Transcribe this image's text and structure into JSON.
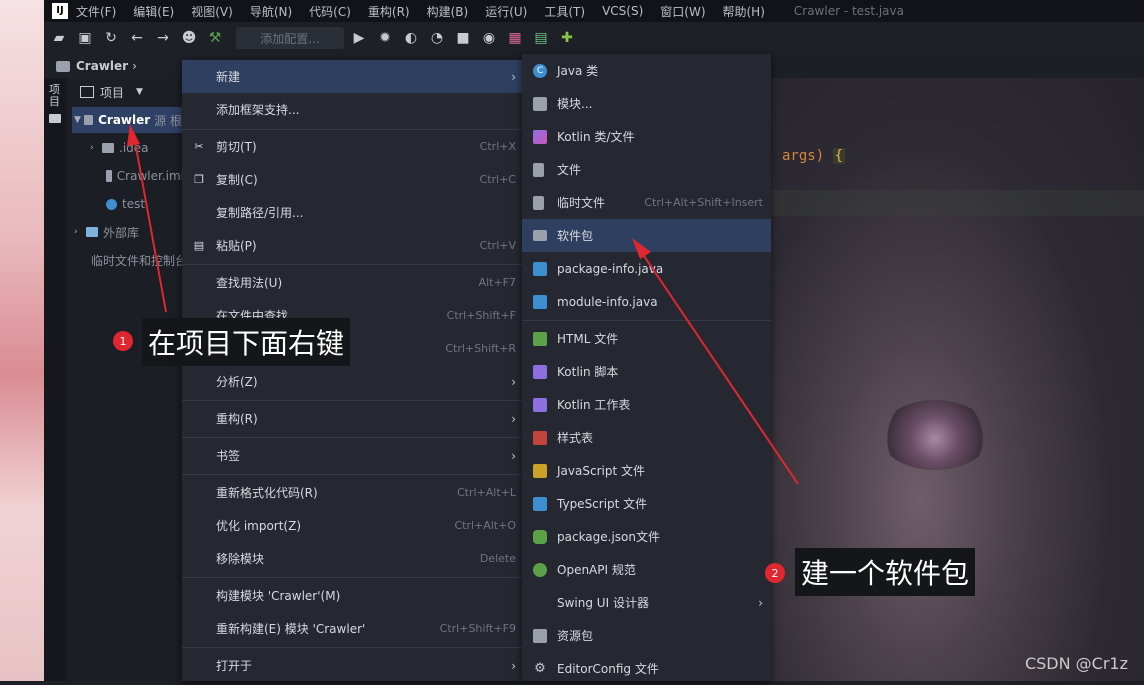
{
  "window_title": "Crawler - test.java",
  "menubar": [
    "文件(F)",
    "编辑(E)",
    "视图(V)",
    "导航(N)",
    "代码(C)",
    "重构(R)",
    "构建(B)",
    "运行(U)",
    "工具(T)",
    "VCS(S)",
    "窗口(W)",
    "帮助(H)"
  ],
  "toolbar": {
    "config_placeholder": "添加配置..."
  },
  "breadcrumb": "Crawler",
  "sidestrip": {
    "label": "项目"
  },
  "project_panel": {
    "header": "项目",
    "tree": [
      {
        "label": "Crawler",
        "suffix": "源 根",
        "selected": true
      },
      {
        "label": ".idea"
      },
      {
        "label": "Crawler.iml"
      },
      {
        "label": "test"
      },
      {
        "label": "外部库"
      },
      {
        "label": "临时文件和控制台"
      }
    ]
  },
  "context_menu": [
    {
      "label": "新建",
      "submenu": true,
      "highlighted": true
    },
    {
      "label": "添加框架支持..."
    },
    {
      "label": "剪切(T)",
      "shortcut": "Ctrl+X",
      "icon": "cut-icon"
    },
    {
      "label": "复制(C)",
      "shortcut": "Ctrl+C",
      "icon": "copy-icon"
    },
    {
      "label": "复制路径/引用..."
    },
    {
      "label": "粘贴(P)",
      "shortcut": "Ctrl+V",
      "icon": "paste-icon"
    },
    {
      "label": "查找用法(U)",
      "shortcut": "Alt+F7"
    },
    {
      "label": "在文件中查找...",
      "shortcut": "Ctrl+Shift+F"
    },
    {
      "label": "",
      "shortcut": "Ctrl+Shift+R"
    },
    {
      "label": "分析(Z)",
      "submenu": true
    },
    {
      "label": "重构(R)",
      "submenu": true
    },
    {
      "label": "书签",
      "submenu": true
    },
    {
      "label": "重新格式化代码(R)",
      "shortcut": "Ctrl+Alt+L"
    },
    {
      "label": "优化 import(Z)",
      "shortcut": "Ctrl+Alt+O"
    },
    {
      "label": "移除模块",
      "shortcut": "Delete"
    },
    {
      "label": "构建模块 'Crawler'(M)"
    },
    {
      "label": "重新构建(E) 模块 'Crawler'",
      "shortcut": "Ctrl+Shift+F9"
    },
    {
      "label": "打开于",
      "submenu": true
    }
  ],
  "new_submenu": [
    {
      "label": "Java 类",
      "icon": "java-class-icon",
      "color": "#3d8fd1"
    },
    {
      "label": "模块...",
      "icon": "module-icon",
      "color": "#9aa1ad"
    },
    {
      "label": "Kotlin 类/文件",
      "icon": "kotlin-icon",
      "color": "#8e6fe0"
    },
    {
      "label": "文件",
      "icon": "file-icon",
      "color": "#9aa1ad"
    },
    {
      "label": "临时文件",
      "shortcut": "Ctrl+Alt+Shift+Insert",
      "icon": "scratch-file-icon",
      "color": "#9aa1ad"
    },
    {
      "label": "软件包",
      "icon": "package-icon",
      "color": "#9aa1ad",
      "highlighted": true
    },
    {
      "label": "package-info.java",
      "icon": "java-file-icon",
      "color": "#3d8fd1"
    },
    {
      "label": "module-info.java",
      "icon": "java-file-icon",
      "color": "#3d8fd1"
    },
    {
      "label": "HTML 文件",
      "icon": "html-icon",
      "color": "#5aa14a"
    },
    {
      "label": "Kotlin 脚本",
      "icon": "kotlin-script-icon",
      "color": "#8e6fe0"
    },
    {
      "label": "Kotlin 工作表",
      "icon": "kotlin-worksheet-icon",
      "color": "#8e6fe0"
    },
    {
      "label": "样式表",
      "icon": "css-icon",
      "color": "#c2443a"
    },
    {
      "label": "JavaScript 文件",
      "icon": "js-icon",
      "color": "#c9a227"
    },
    {
      "label": "TypeScript 文件",
      "icon": "ts-icon",
      "color": "#3d8fd1"
    },
    {
      "label": "package.json文件",
      "icon": "nodejs-icon",
      "color": "#5aa14a"
    },
    {
      "label": "OpenAPI 规范",
      "icon": "openapi-icon",
      "color": "#5aa14a"
    },
    {
      "label": "Swing UI 设计器",
      "submenu": true
    },
    {
      "label": "资源包",
      "icon": "resource-bundle-icon",
      "color": "#9aa1ad"
    },
    {
      "label": "EditorConfig 文件",
      "icon": "gear-icon",
      "color": "#9aa1ad"
    }
  ],
  "editor": {
    "code_text": "args)",
    "brace": "{"
  },
  "annotations": [
    {
      "badge": "1",
      "text": "在项目下面右键"
    },
    {
      "badge": "2",
      "text": "建一个软件包"
    }
  ],
  "watermark": "CSDN @Cr1z",
  "colors": {
    "highlight": "#2e3f5f",
    "menu_bg": "#252831",
    "badge_red": "#e0262f",
    "arrow_red": "#e0262f"
  }
}
